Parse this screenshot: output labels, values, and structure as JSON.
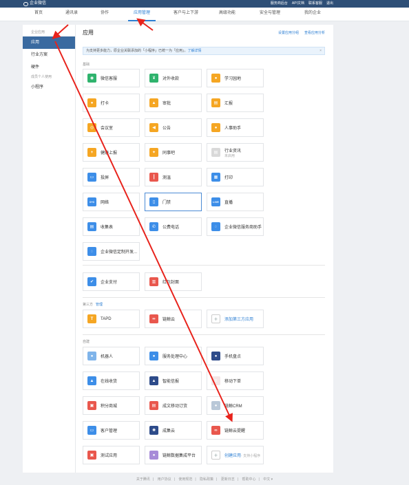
{
  "topbar": {
    "logo_text": "企业微信",
    "links": [
      "服务商后台",
      "API文档",
      "联系客服",
      "退出"
    ]
  },
  "nav": {
    "tabs": [
      "首页",
      "通讯录",
      "协作",
      "应用管理",
      "客户与上下游",
      "高级功能",
      "安全与管理",
      "我的企业"
    ],
    "active": "应用管理"
  },
  "sidebar": {
    "section1": "企业应用",
    "items": [
      "应用",
      "行业方案",
      "硬件"
    ],
    "section2": "成员个人使用",
    "items2": [
      "小程序"
    ]
  },
  "main": {
    "title": "应用",
    "links": [
      "设置应用分组",
      "查看应用分析"
    ],
    "notice": "为支持更多能力，原企业关联添加的「小程序」已统一为「应用」。",
    "notice_link": "了解详情",
    "notice_close": "×",
    "section_basic": "基础",
    "section_third": "第三方",
    "section_third_link": "管理",
    "section_custom": "自建"
  },
  "apps_basic": [
    {
      "label": "微信客服",
      "color": "#2fb36d",
      "glyph": "◉"
    },
    {
      "label": "对外收款",
      "color": "#2fb36d",
      "glyph": "¥"
    },
    {
      "label": "学习园地",
      "color": "#f5a623",
      "glyph": "●"
    },
    {
      "label": "打卡",
      "color": "#f5a623",
      "glyph": "●"
    },
    {
      "label": "审批",
      "color": "#f5a623",
      "glyph": "▲"
    },
    {
      "label": "汇报",
      "color": "#f5a623",
      "glyph": "▤"
    },
    {
      "label": "会议室",
      "color": "#f5a623",
      "glyph": "◎"
    },
    {
      "label": "公告",
      "color": "#f5a623",
      "glyph": "◀"
    },
    {
      "label": "人事助手",
      "color": "#f5a623",
      "glyph": "●"
    },
    {
      "label": "健康上报",
      "color": "#f5a623",
      "glyph": "+"
    },
    {
      "label": "同事吧",
      "color": "#f5a623",
      "glyph": "✦"
    },
    {
      "label": "行业资讯",
      "sub": "未启用",
      "color": "#d9d9d9",
      "glyph": "▤"
    },
    {
      "label": "投屏",
      "color": "#3d8ee8",
      "glyph": "▭"
    },
    {
      "label": "测温",
      "color": "#e9574d",
      "glyph": "┃"
    },
    {
      "label": "打印",
      "color": "#3d8ee8",
      "glyph": "▦"
    },
    {
      "label": "网络",
      "color": "#3d8ee8",
      "glyph": "0+0"
    },
    {
      "label": "门禁",
      "color": "#3d8ee8",
      "glyph": "▯"
    },
    {
      "label": "直播",
      "color": "#3d8ee8",
      "glyph": "LIVE"
    },
    {
      "label": "收集表",
      "color": "#3d8ee8",
      "glyph": "▤"
    },
    {
      "label": "公费电话",
      "color": "#3d8ee8",
      "glyph": "✆"
    },
    {
      "label": "企业微信服务商助手",
      "color": "#3d8ee8",
      "glyph": "◌"
    },
    {
      "label": "企业微信定制开发...",
      "color": "#3d8ee8",
      "glyph": "◌"
    }
  ],
  "apps_pay": [
    {
      "label": "企业支付",
      "color": "#3d8ee8",
      "glyph": "✔"
    },
    {
      "label": "红包封面",
      "color": "#e9574d",
      "glyph": "▥"
    }
  ],
  "apps_third": [
    {
      "label": "TAPD",
      "color": "#f5a623",
      "glyph": "T"
    },
    {
      "label": "链鲸云",
      "color": "#e9574d",
      "glyph": "∞"
    },
    {
      "label": "添加第三方应用",
      "plus": true
    }
  ],
  "apps_custom": [
    {
      "label": "机器人",
      "color": "#7fb4ea",
      "glyph": "●"
    },
    {
      "label": "服务处理中心",
      "color": "#3d8ee8",
      "glyph": "●"
    },
    {
      "label": "手机盘点",
      "color": "#2d4b8a",
      "glyph": "●"
    },
    {
      "label": "在线收货",
      "color": "#3d8ee8",
      "glyph": "▲"
    },
    {
      "label": "智能信报",
      "color": "#2d4b8a",
      "glyph": "▲"
    },
    {
      "label": "移动下单",
      "color": "#f3e6e6",
      "glyph": "≡"
    },
    {
      "label": "积分商城",
      "color": "#e9574d",
      "glyph": "▣"
    },
    {
      "label": "成文移动订货",
      "color": "#e9574d",
      "glyph": "▤"
    },
    {
      "label": "链鲸CRM",
      "color": "#b9c8d8",
      "glyph": "●"
    },
    {
      "label": "客户管理",
      "color": "#3d8ee8",
      "glyph": "▭"
    },
    {
      "label": "成集云",
      "color": "#2d4b8a",
      "glyph": "✺"
    },
    {
      "label": "链鲸云提醒",
      "color": "#e9574d",
      "glyph": "∞"
    },
    {
      "label": "测试应用",
      "color": "#e9574d",
      "glyph": "▣"
    },
    {
      "label": "链鲸数据集成平台",
      "color": "#a78bd8",
      "glyph": "●"
    },
    {
      "label": "创建应用",
      "sub": "· 支持小程序",
      "plus": true
    }
  ],
  "footer": [
    "关于腾讯",
    "用户协议",
    "使用规范",
    "隐私政策",
    "更新日志",
    "帮助中心",
    "中文 ▾"
  ]
}
